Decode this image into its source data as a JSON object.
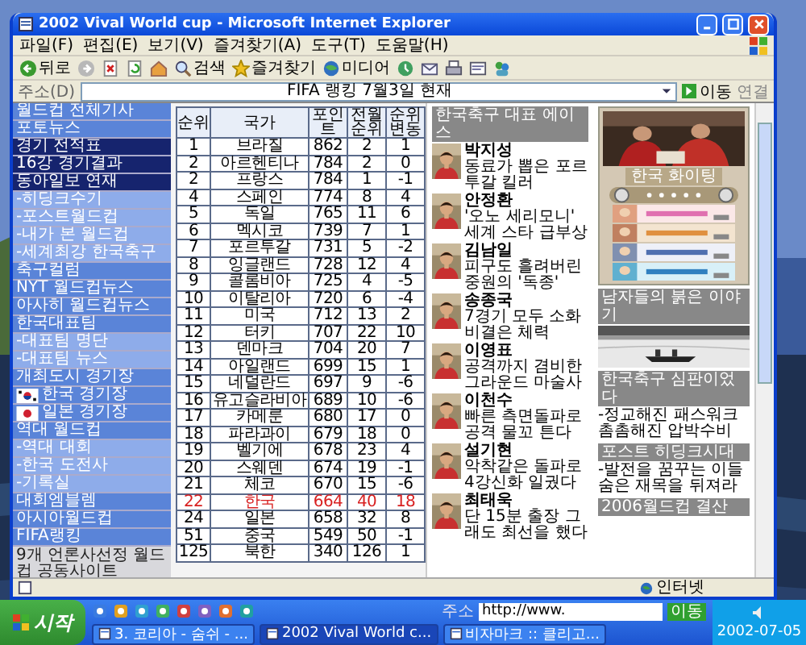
{
  "window": {
    "title": "2002 Vival World cup - Microsoft Internet Explorer"
  },
  "menu": [
    "파일(F)",
    "편집(E)",
    "보기(V)",
    "즐겨찾기(A)",
    "도구(T)",
    "도움말(H)"
  ],
  "toolbar": [
    {
      "kind": "back",
      "label": "뒤로"
    },
    {
      "kind": "forward"
    },
    {
      "kind": "stop"
    },
    {
      "kind": "refresh"
    },
    {
      "kind": "home"
    },
    {
      "kind": "search",
      "label": "검색"
    },
    {
      "kind": "favorites",
      "label": "즐겨찾기"
    },
    {
      "kind": "media",
      "label": "미디어"
    },
    {
      "kind": "history"
    },
    {
      "kind": "mail"
    },
    {
      "kind": "print"
    },
    {
      "kind": "edit"
    },
    {
      "kind": "messenger"
    }
  ],
  "address": {
    "label": "주소(D)",
    "value": "FIFA 랭킹 7월3일 현재",
    "go": "이동",
    "links": "연결"
  },
  "sidebar": [
    {
      "label": "월드컵 전체기사",
      "kind": "item"
    },
    {
      "label": "포토뉴스",
      "kind": "item"
    },
    {
      "label": "경기 전적표",
      "kind": "dark"
    },
    {
      "label": "16강 경기결과",
      "kind": "dark"
    },
    {
      "label": "동아일보 연재",
      "kind": "dark"
    },
    {
      "label": "-히딩크수기",
      "kind": "sub"
    },
    {
      "label": "-포스트월드컵",
      "kind": "sub"
    },
    {
      "label": "-내가 본 월드컵",
      "kind": "sub"
    },
    {
      "label": "-세계최강 한국축구",
      "kind": "sub"
    },
    {
      "label": "축구컬럼",
      "kind": "item"
    },
    {
      "label": "NYT 월드컵뉴스",
      "kind": "item"
    },
    {
      "label": "아사히 월드컵뉴스",
      "kind": "item"
    },
    {
      "label": "한국대표팀",
      "kind": "item"
    },
    {
      "label": "-대표팀 명단",
      "kind": "sub"
    },
    {
      "label": "-대표팀 뉴스",
      "kind": "sub"
    },
    {
      "label": "개최도시 경기장",
      "kind": "item"
    },
    {
      "label": "한국 경기장",
      "kind": "flag-korea"
    },
    {
      "label": "일본 경기장",
      "kind": "flag-japan"
    },
    {
      "label": "역대 월드컵",
      "kind": "item"
    },
    {
      "label": "-역대 대회",
      "kind": "sub"
    },
    {
      "label": "-한국 도전사",
      "kind": "sub"
    },
    {
      "label": "-기록실",
      "kind": "sub"
    },
    {
      "label": "대회엠블렘",
      "kind": "item"
    },
    {
      "label": "아시아월드컵",
      "kind": "item"
    },
    {
      "label": "FIFA랭킹",
      "kind": "item"
    },
    {
      "label": "9개 언론사선정 월드컵 공동사이트",
      "kind": "note"
    }
  ],
  "table": {
    "columns": [
      "순위",
      "국가",
      "포인트",
      "전월순위",
      "순위변동"
    ],
    "rows": [
      {
        "cells": [
          "1",
          "브라질",
          "862",
          "2",
          "1"
        ],
        "highlight": false
      },
      {
        "cells": [
          "2",
          "아르헨티나",
          "784",
          "2",
          "0"
        ],
        "highlight": false
      },
      {
        "cells": [
          "2",
          "프랑스",
          "784",
          "1",
          "-1"
        ],
        "highlight": false
      },
      {
        "cells": [
          "4",
          "스페인",
          "774",
          "8",
          "4"
        ],
        "highlight": false
      },
      {
        "cells": [
          "5",
          "독일",
          "765",
          "11",
          "6"
        ],
        "highlight": false
      },
      {
        "cells": [
          "6",
          "멕시코",
          "739",
          "7",
          "1"
        ],
        "highlight": false
      },
      {
        "cells": [
          "7",
          "포르투갈",
          "731",
          "5",
          "-2"
        ],
        "highlight": false
      },
      {
        "cells": [
          "8",
          "잉글랜드",
          "728",
          "12",
          "4"
        ],
        "highlight": false
      },
      {
        "cells": [
          "9",
          "콜롬비아",
          "725",
          "4",
          "-5"
        ],
        "highlight": false
      },
      {
        "cells": [
          "10",
          "이탈리아",
          "720",
          "6",
          "-4"
        ],
        "highlight": false
      },
      {
        "cells": [
          "11",
          "미국",
          "712",
          "13",
          "2"
        ],
        "highlight": false
      },
      {
        "cells": [
          "12",
          "터키",
          "707",
          "22",
          "10"
        ],
        "highlight": false
      },
      {
        "cells": [
          "13",
          "덴마크",
          "704",
          "20",
          "7"
        ],
        "highlight": false
      },
      {
        "cells": [
          "14",
          "아일랜드",
          "699",
          "15",
          "1"
        ],
        "highlight": false
      },
      {
        "cells": [
          "15",
          "네덜란드",
          "697",
          "9",
          "-6"
        ],
        "highlight": false
      },
      {
        "cells": [
          "16",
          "유고슬라비아",
          "689",
          "10",
          "-6"
        ],
        "highlight": false
      },
      {
        "cells": [
          "17",
          "카메룬",
          "680",
          "17",
          "0"
        ],
        "highlight": false
      },
      {
        "cells": [
          "18",
          "파라과이",
          "679",
          "18",
          "0"
        ],
        "highlight": false
      },
      {
        "cells": [
          "19",
          "벨기에",
          "678",
          "23",
          "4"
        ],
        "highlight": false
      },
      {
        "cells": [
          "20",
          "스웨덴",
          "674",
          "19",
          "-1"
        ],
        "highlight": false
      },
      {
        "cells": [
          "21",
          "체코",
          "670",
          "15",
          "-6"
        ],
        "highlight": false
      },
      {
        "cells": [
          "22",
          "한국",
          "664",
          "40",
          "18"
        ],
        "highlight": true
      },
      {
        "cells": [
          "24",
          "일본",
          "658",
          "32",
          "8"
        ],
        "highlight": false
      },
      {
        "cells": [
          "51",
          "중국",
          "549",
          "50",
          "-1"
        ],
        "highlight": false
      },
      {
        "cells": [
          "125",
          "북한",
          "340",
          "126",
          "1"
        ],
        "highlight": false
      }
    ]
  },
  "players": {
    "heading": "한국축구 대표 에이스",
    "items": [
      {
        "name": "박지성",
        "caption": "동료가 뽑은 포르투갈 킬러"
      },
      {
        "name": "안정환",
        "caption": "'오노 세리모니' 세계 스타 급부상"
      },
      {
        "name": "김남일",
        "caption": "피구도 흘려버린 중원의 '독종'"
      },
      {
        "name": "송종국",
        "caption": "7경기 모두 소화 비결은 체력"
      },
      {
        "name": "이영표",
        "caption": "공격까지 겸비한 그라운드 마술사"
      },
      {
        "name": "이천수",
        "caption": "빠른 측면돌파로 공격 물꼬 튼다"
      },
      {
        "name": "설기현",
        "caption": "악착같은 돌파로 4강신화 일궜다"
      },
      {
        "name": "최태욱",
        "caption": "단 15분 출장 그래도 최선을 했다"
      }
    ]
  },
  "promo": {
    "caption": "한국 화이팅"
  },
  "sections": [
    {
      "heading": "남자들의 붉은 이야기"
    },
    {
      "kind": "text",
      "heading": "한국축구 심판이었다",
      "text": "-정교해진 패스워크 촘촘해진 압박수비"
    },
    {
      "kind": "text",
      "heading": "포스트 히딩크시대",
      "text": "-발전을 꿈꾸는 이들 숨은 재목을 뒤져라"
    },
    {
      "kind": "text",
      "heading": "2006월드컵 결산"
    }
  ],
  "status": {
    "zone": "인터넷"
  },
  "taskbar": {
    "start": "시작",
    "address_label": "주소",
    "address_value": "http://www.",
    "go": "이동",
    "tasks": [
      {
        "label": "3. 코리아 - 숨쉬 - ...",
        "selected": false
      },
      {
        "label": "2002 Vival World c...",
        "selected": true
      },
      {
        "label": "비자마크 :: 클리고...",
        "selected": false
      }
    ],
    "clock": "2002-07-05"
  }
}
